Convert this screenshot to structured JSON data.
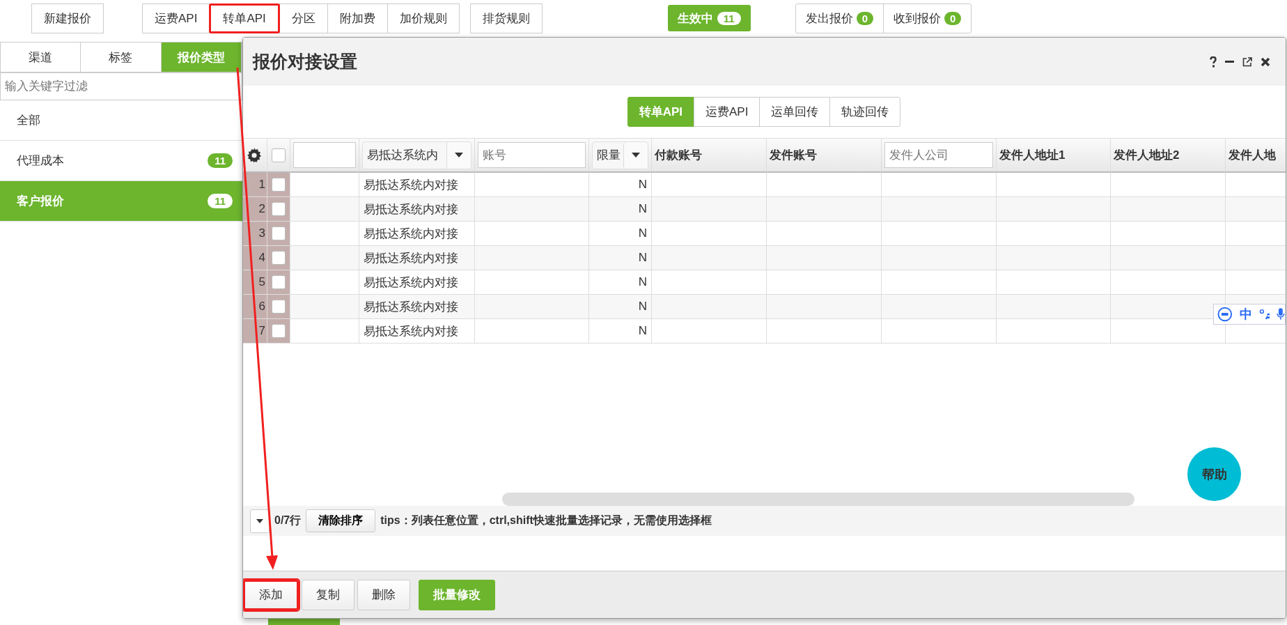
{
  "toolbar": {
    "groups": [
      {
        "buttons": [
          {
            "label": "新建报价",
            "highlighted": false
          }
        ]
      },
      {
        "buttons": [
          {
            "label": "运费API",
            "highlighted": false
          },
          {
            "label": "转单API",
            "highlighted": true
          },
          {
            "label": "分区",
            "highlighted": false
          },
          {
            "label": "附加费",
            "highlighted": false
          },
          {
            "label": "加价规则",
            "highlighted": false
          }
        ]
      },
      {
        "buttons": [
          {
            "label": "排货规则",
            "highlighted": false
          }
        ]
      }
    ],
    "status": {
      "label": "生效中",
      "count": "11"
    },
    "counters": [
      {
        "label": "发出报价",
        "count": "0"
      },
      {
        "label": "收到报价",
        "count": "0"
      }
    ]
  },
  "sidebar": {
    "tabs": [
      {
        "label": "渠道",
        "selected": false
      },
      {
        "label": "标签",
        "selected": false
      },
      {
        "label": "报价类型",
        "selected": true
      }
    ],
    "filter": {
      "placeholder": "输入关键字过滤"
    },
    "items": [
      {
        "label": "全部",
        "selected": false
      },
      {
        "label": "代理成本",
        "count": "11",
        "selected": false
      },
      {
        "label": "客户报价",
        "count": "11",
        "selected": true
      }
    ]
  },
  "dialog": {
    "title": "报价对接设置",
    "tabs": [
      {
        "label": "转单API",
        "selected": true
      },
      {
        "label": "运费API",
        "selected": false
      },
      {
        "label": "运单回传",
        "selected": false
      },
      {
        "label": "轨迹回传",
        "selected": false
      }
    ],
    "table": {
      "columns": [
        {
          "kind": "settings"
        },
        {
          "kind": "checkbox",
          "checked": false
        },
        {
          "kind": "input"
        },
        {
          "kind": "select",
          "label": "易抵达系统内"
        },
        {
          "kind": "input",
          "placeholder": "账号"
        },
        {
          "kind": "select",
          "label": "限量"
        },
        {
          "kind": "text",
          "label": "付款账号"
        },
        {
          "kind": "text",
          "label": "发件账号"
        },
        {
          "kind": "input",
          "placeholder": "发件人公司"
        },
        {
          "kind": "text",
          "label": "发件人地址1"
        },
        {
          "kind": "text",
          "label": "发件人地址2"
        },
        {
          "kind": "text",
          "label": "发件人地"
        }
      ],
      "rows": [
        {
          "number": "1",
          "checked": false,
          "integration": "易抵达系统内对接",
          "limit": "N"
        },
        {
          "number": "2",
          "checked": false,
          "integration": "易抵达系统内对接",
          "limit": "N"
        },
        {
          "number": "3",
          "checked": false,
          "integration": "易抵达系统内对接",
          "limit": "N"
        },
        {
          "number": "4",
          "checked": false,
          "integration": "易抵达系统内对接",
          "limit": "N"
        },
        {
          "number": "5",
          "checked": false,
          "integration": "易抵达系统内对接",
          "limit": "N"
        },
        {
          "number": "6",
          "checked": false,
          "integration": "易抵达系统内对接",
          "limit": "N"
        },
        {
          "number": "7",
          "checked": false,
          "integration": "易抵达系统内对接",
          "limit": "N"
        }
      ]
    },
    "footer": {
      "row_count": "0/7行",
      "clear_sort": "清除排序",
      "tips": "tips：列表任意位置，ctrl,shift快速批量选择记录，无需使用选择框"
    },
    "help": "帮助",
    "actions": [
      {
        "label": "添加",
        "kind": "plain",
        "highlighted": true
      },
      {
        "label": "复制",
        "kind": "plain",
        "highlighted": false
      },
      {
        "label": "删除",
        "kind": "plain",
        "highlighted": false
      },
      {
        "label": "批量修改",
        "kind": "primary",
        "highlighted": false
      }
    ]
  },
  "ime_toolbar": {
    "mode": "中"
  }
}
